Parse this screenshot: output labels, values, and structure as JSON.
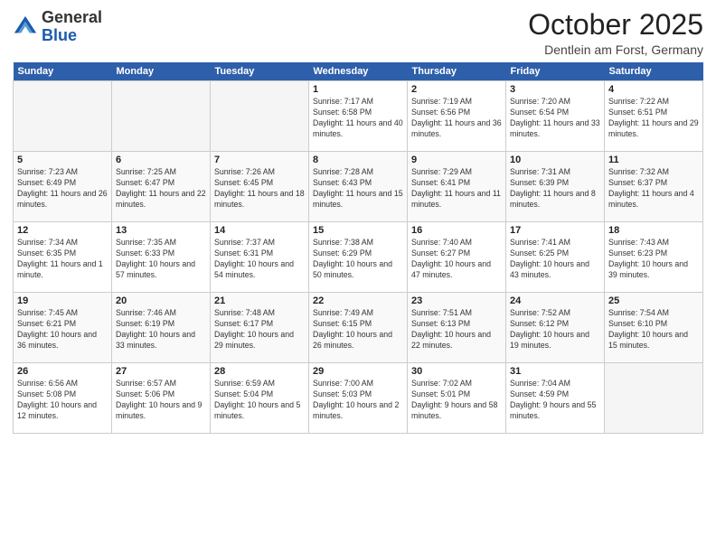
{
  "header": {
    "logo_general": "General",
    "logo_blue": "Blue",
    "month_title": "October 2025",
    "location": "Dentlein am Forst, Germany"
  },
  "weekdays": [
    "Sunday",
    "Monday",
    "Tuesday",
    "Wednesday",
    "Thursday",
    "Friday",
    "Saturday"
  ],
  "weeks": [
    [
      {
        "day": "",
        "info": ""
      },
      {
        "day": "",
        "info": ""
      },
      {
        "day": "",
        "info": ""
      },
      {
        "day": "1",
        "info": "Sunrise: 7:17 AM\nSunset: 6:58 PM\nDaylight: 11 hours and 40 minutes."
      },
      {
        "day": "2",
        "info": "Sunrise: 7:19 AM\nSunset: 6:56 PM\nDaylight: 11 hours and 36 minutes."
      },
      {
        "day": "3",
        "info": "Sunrise: 7:20 AM\nSunset: 6:54 PM\nDaylight: 11 hours and 33 minutes."
      },
      {
        "day": "4",
        "info": "Sunrise: 7:22 AM\nSunset: 6:51 PM\nDaylight: 11 hours and 29 minutes."
      }
    ],
    [
      {
        "day": "5",
        "info": "Sunrise: 7:23 AM\nSunset: 6:49 PM\nDaylight: 11 hours and 26 minutes."
      },
      {
        "day": "6",
        "info": "Sunrise: 7:25 AM\nSunset: 6:47 PM\nDaylight: 11 hours and 22 minutes."
      },
      {
        "day": "7",
        "info": "Sunrise: 7:26 AM\nSunset: 6:45 PM\nDaylight: 11 hours and 18 minutes."
      },
      {
        "day": "8",
        "info": "Sunrise: 7:28 AM\nSunset: 6:43 PM\nDaylight: 11 hours and 15 minutes."
      },
      {
        "day": "9",
        "info": "Sunrise: 7:29 AM\nSunset: 6:41 PM\nDaylight: 11 hours and 11 minutes."
      },
      {
        "day": "10",
        "info": "Sunrise: 7:31 AM\nSunset: 6:39 PM\nDaylight: 11 hours and 8 minutes."
      },
      {
        "day": "11",
        "info": "Sunrise: 7:32 AM\nSunset: 6:37 PM\nDaylight: 11 hours and 4 minutes."
      }
    ],
    [
      {
        "day": "12",
        "info": "Sunrise: 7:34 AM\nSunset: 6:35 PM\nDaylight: 11 hours and 1 minute."
      },
      {
        "day": "13",
        "info": "Sunrise: 7:35 AM\nSunset: 6:33 PM\nDaylight: 10 hours and 57 minutes."
      },
      {
        "day": "14",
        "info": "Sunrise: 7:37 AM\nSunset: 6:31 PM\nDaylight: 10 hours and 54 minutes."
      },
      {
        "day": "15",
        "info": "Sunrise: 7:38 AM\nSunset: 6:29 PM\nDaylight: 10 hours and 50 minutes."
      },
      {
        "day": "16",
        "info": "Sunrise: 7:40 AM\nSunset: 6:27 PM\nDaylight: 10 hours and 47 minutes."
      },
      {
        "day": "17",
        "info": "Sunrise: 7:41 AM\nSunset: 6:25 PM\nDaylight: 10 hours and 43 minutes."
      },
      {
        "day": "18",
        "info": "Sunrise: 7:43 AM\nSunset: 6:23 PM\nDaylight: 10 hours and 39 minutes."
      }
    ],
    [
      {
        "day": "19",
        "info": "Sunrise: 7:45 AM\nSunset: 6:21 PM\nDaylight: 10 hours and 36 minutes."
      },
      {
        "day": "20",
        "info": "Sunrise: 7:46 AM\nSunset: 6:19 PM\nDaylight: 10 hours and 33 minutes."
      },
      {
        "day": "21",
        "info": "Sunrise: 7:48 AM\nSunset: 6:17 PM\nDaylight: 10 hours and 29 minutes."
      },
      {
        "day": "22",
        "info": "Sunrise: 7:49 AM\nSunset: 6:15 PM\nDaylight: 10 hours and 26 minutes."
      },
      {
        "day": "23",
        "info": "Sunrise: 7:51 AM\nSunset: 6:13 PM\nDaylight: 10 hours and 22 minutes."
      },
      {
        "day": "24",
        "info": "Sunrise: 7:52 AM\nSunset: 6:12 PM\nDaylight: 10 hours and 19 minutes."
      },
      {
        "day": "25",
        "info": "Sunrise: 7:54 AM\nSunset: 6:10 PM\nDaylight: 10 hours and 15 minutes."
      }
    ],
    [
      {
        "day": "26",
        "info": "Sunrise: 6:56 AM\nSunset: 5:08 PM\nDaylight: 10 hours and 12 minutes."
      },
      {
        "day": "27",
        "info": "Sunrise: 6:57 AM\nSunset: 5:06 PM\nDaylight: 10 hours and 9 minutes."
      },
      {
        "day": "28",
        "info": "Sunrise: 6:59 AM\nSunset: 5:04 PM\nDaylight: 10 hours and 5 minutes."
      },
      {
        "day": "29",
        "info": "Sunrise: 7:00 AM\nSunset: 5:03 PM\nDaylight: 10 hours and 2 minutes."
      },
      {
        "day": "30",
        "info": "Sunrise: 7:02 AM\nSunset: 5:01 PM\nDaylight: 9 hours and 58 minutes."
      },
      {
        "day": "31",
        "info": "Sunrise: 7:04 AM\nSunset: 4:59 PM\nDaylight: 9 hours and 55 minutes."
      },
      {
        "day": "",
        "info": ""
      }
    ]
  ]
}
